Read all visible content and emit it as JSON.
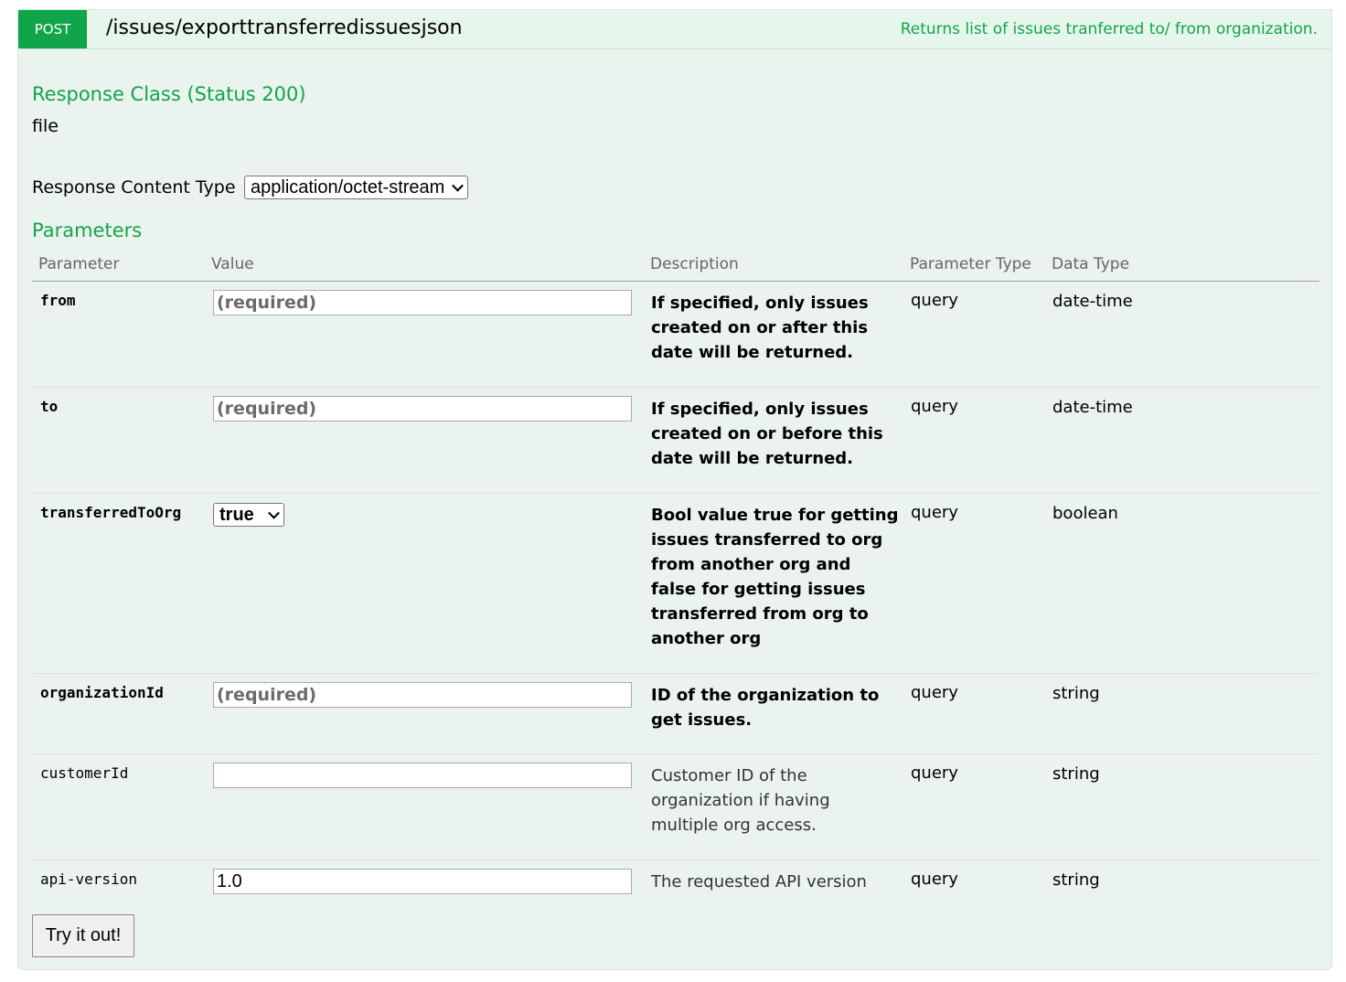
{
  "operation": {
    "method": "POST",
    "path": "/issues/exporttransferredissuesjson",
    "summary": "Returns list of issues tranferred to/ from organization."
  },
  "response_class": {
    "heading": "Response Class (Status 200)",
    "type": "file"
  },
  "response_content_type": {
    "label": "Response Content Type",
    "selected": "application/octet-stream"
  },
  "parameters": {
    "heading": "Parameters",
    "columns": {
      "parameter": "Parameter",
      "value": "Value",
      "description": "Description",
      "parameter_type": "Parameter Type",
      "data_type": "Data Type"
    },
    "rows": [
      {
        "name": "from",
        "value_placeholder": "(required)",
        "description": "If specified, only issues created on or after this date will be returned.",
        "param_type": "query",
        "data_type": "date-time"
      },
      {
        "name": "to",
        "value_placeholder": "(required)",
        "description": "If specified, only issues created on or before this date will be returned.",
        "param_type": "query",
        "data_type": "date-time"
      },
      {
        "name": "transferredToOrg",
        "value_selected": "true",
        "description": "Bool value true for getting issues transferred to org from another org and false for getting issues transferred from org to another org",
        "param_type": "query",
        "data_type": "boolean"
      },
      {
        "name": "organizationId",
        "value_placeholder": "(required)",
        "description": "ID of the organization to get issues.",
        "param_type": "query",
        "data_type": "string"
      },
      {
        "name": "customerId",
        "value": "",
        "description": "Customer ID of the organization if having multiple org access.",
        "param_type": "query",
        "data_type": "string"
      },
      {
        "name": "api-version",
        "value": "1.0",
        "description": "The requested API version",
        "param_type": "query",
        "data_type": "string"
      }
    ]
  },
  "try_button": "Try it out!",
  "colors": {
    "method_badge": "#10a54a",
    "heading_green": "#10a54a",
    "panel_bg": "#ebf3ee",
    "header_bg": "#e7f6ec"
  }
}
